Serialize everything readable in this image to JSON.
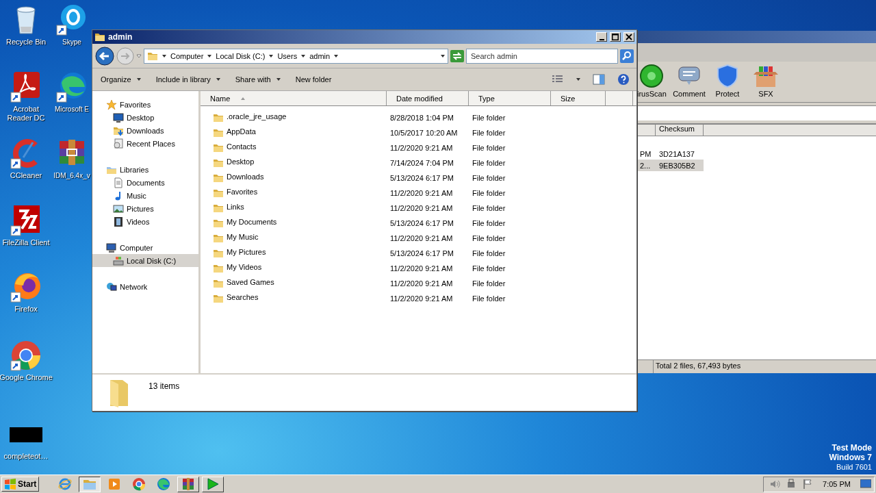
{
  "desktop_icons": [
    {
      "label": "Recycle Bin",
      "kind": "recycle"
    },
    {
      "label": "Skype",
      "kind": "skype"
    },
    {
      "label": "Acrobat Reader DC",
      "kind": "acrobat"
    },
    {
      "label": "Microsoft E",
      "kind": "edge"
    },
    {
      "label": "CCleaner",
      "kind": "ccleaner"
    },
    {
      "label": "IDM_6.4x_v",
      "kind": "archive"
    },
    {
      "label": "FileZilla Client",
      "kind": "filezilla"
    },
    {
      "label": "Firefox",
      "kind": "firefox"
    },
    {
      "label": "Google Chrome",
      "kind": "chrome"
    },
    {
      "label": "completeot…",
      "kind": "file"
    }
  ],
  "background_window": {
    "tools": [
      {
        "label": "irusScan",
        "kind": "virus"
      },
      {
        "label": "Comment",
        "kind": "comment"
      },
      {
        "label": "Protect",
        "kind": "protect"
      },
      {
        "label": "SFX",
        "kind": "sfx"
      }
    ],
    "columns": [
      "Checksum"
    ],
    "rows": [
      {
        "column_1": "PM",
        "checksum": "3D21A137",
        "selected": false
      },
      {
        "column_1": "2...",
        "checksum": "9EB305B2",
        "selected": true
      }
    ],
    "status": "Total 2 files, 67,493 bytes"
  },
  "explorer": {
    "title": "admin",
    "breadcrumb": [
      "Computer",
      "Local Disk (C:)",
      "Users",
      "admin"
    ],
    "search": {
      "placeholder": "Search admin"
    },
    "toolbar": [
      {
        "label": "Organize",
        "menu": true
      },
      {
        "label": "Include in library",
        "menu": true
      },
      {
        "label": "Share with",
        "menu": true
      },
      {
        "label": "New folder",
        "menu": false
      }
    ],
    "nav": [
      {
        "label": "Favorites",
        "kind": "star",
        "selected": false,
        "children": [
          {
            "label": "Desktop",
            "kind": "desktop",
            "selected": false
          },
          {
            "label": "Downloads",
            "kind": "downloads",
            "selected": false
          },
          {
            "label": "Recent Places",
            "kind": "recent",
            "selected": false
          }
        ]
      },
      {
        "label": "Libraries",
        "kind": "libraries",
        "selected": false,
        "children": [
          {
            "label": "Documents",
            "kind": "document",
            "selected": false
          },
          {
            "label": "Music",
            "kind": "music",
            "selected": false
          },
          {
            "label": "Pictures",
            "kind": "pictures",
            "selected": false
          },
          {
            "label": "Videos",
            "kind": "videos",
            "selected": false
          }
        ]
      },
      {
        "label": "Computer",
        "kind": "computer",
        "selected": false,
        "children": [
          {
            "label": "Local Disk (C:)",
            "kind": "disk",
            "selected": true
          }
        ]
      },
      {
        "label": "Network",
        "kind": "network",
        "selected": false
      }
    ],
    "columns": [
      {
        "label": "Name",
        "sorted": true
      },
      {
        "label": "Date modified",
        "sorted": false
      },
      {
        "label": "Type",
        "sorted": false
      },
      {
        "label": "Size",
        "sorted": false
      }
    ],
    "rows": [
      {
        "name": ".oracle_jre_usage",
        "date": "8/28/2018 1:04 PM",
        "type": "File folder"
      },
      {
        "name": "AppData",
        "date": "10/5/2017 10:20 AM",
        "type": "File folder"
      },
      {
        "name": "Contacts",
        "date": "11/2/2020 9:21 AM",
        "type": "File folder"
      },
      {
        "name": "Desktop",
        "date": "7/14/2024 7:04 PM",
        "type": "File folder"
      },
      {
        "name": "Downloads",
        "date": "5/13/2024 6:17 PM",
        "type": "File folder"
      },
      {
        "name": "Favorites",
        "date": "11/2/2020 9:21 AM",
        "type": "File folder"
      },
      {
        "name": "Links",
        "date": "11/2/2020 9:21 AM",
        "type": "File folder"
      },
      {
        "name": "My Documents",
        "date": "5/13/2024 6:17 PM",
        "type": "File folder"
      },
      {
        "name": "My Music",
        "date": "11/2/2020 9:21 AM",
        "type": "File folder"
      },
      {
        "name": "My Pictures",
        "date": "5/13/2024 6:17 PM",
        "type": "File folder"
      },
      {
        "name": "My Videos",
        "date": "11/2/2020 9:21 AM",
        "type": "File folder"
      },
      {
        "name": "Saved Games",
        "date": "11/2/2020 9:21 AM",
        "type": "File folder"
      },
      {
        "name": "Searches",
        "date": "11/2/2020 9:21 AM",
        "type": "File folder"
      }
    ],
    "details": "13 items"
  },
  "os_info": [
    {
      "text": "Test Mode",
      "bold": true
    },
    {
      "text": "Windows 7",
      "bold": true
    },
    {
      "text": "Build 7601",
      "bold": false
    }
  ],
  "taskbar": {
    "start": "Start",
    "apps": [
      {
        "kind": "ie",
        "running": false,
        "selected": false
      },
      {
        "kind": "folder",
        "running": true,
        "selected": true
      },
      {
        "kind": "media",
        "running": false,
        "selected": false
      },
      {
        "kind": "chrome",
        "running": false,
        "selected": false
      },
      {
        "kind": "edge",
        "running": false,
        "selected": false
      },
      {
        "kind": "archive",
        "running": true,
        "selected": false
      },
      {
        "kind": "play",
        "running": true,
        "selected": false
      }
    ],
    "clock": "7:05 PM"
  }
}
